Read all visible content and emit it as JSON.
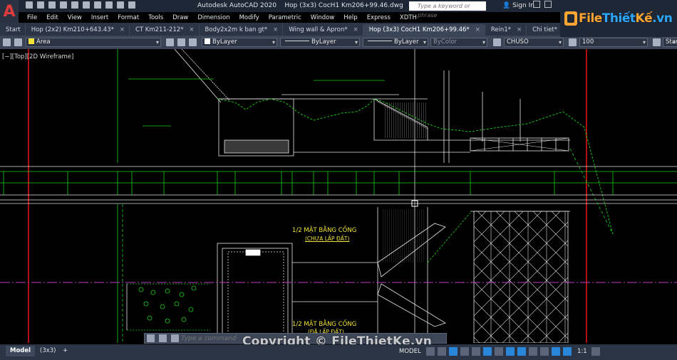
{
  "app": {
    "title": "Autodesk AutoCAD 2020",
    "filename": "Hop (3x3) CocH1 Km206+99.46.dwg",
    "logo_letter": "A"
  },
  "search": {
    "placeholder": "Type a keyword or phrase"
  },
  "account": {
    "signin_label": "Sign In"
  },
  "menu": [
    "File",
    "Edit",
    "View",
    "Insert",
    "Format",
    "Tools",
    "Draw",
    "Dimension",
    "Modify",
    "Parametric",
    "Window",
    "Help",
    "Express",
    "XDTH"
  ],
  "tabs": [
    {
      "label": "Start",
      "closable": false,
      "active": false
    },
    {
      "label": "Hop (2x2)  Km210+643.43*",
      "closable": true,
      "active": false
    },
    {
      "label": "CT Km211-212*",
      "closable": true,
      "active": false
    },
    {
      "label": "Body2x2m k ban gt*",
      "closable": true,
      "active": false
    },
    {
      "label": "Wing wall & Apron*",
      "closable": true,
      "active": false
    },
    {
      "label": "Hop (3x3) CocH1 Km206+99.46*",
      "closable": true,
      "active": true
    },
    {
      "label": "Rein1*",
      "closable": true,
      "active": false
    },
    {
      "label": "Chi tiet*",
      "closable": true,
      "active": false
    }
  ],
  "properties": {
    "layer": "Area",
    "color": "ByLayer",
    "linetype": "ByLayer",
    "lineweight": "ByLayer",
    "plotstyle": "ByColor",
    "textstyle": "CHUSO",
    "dimscale": "100",
    "tablestyle": "Standard"
  },
  "viewport": {
    "label": "[−][Top][2D Wireframe]"
  },
  "drawing": {
    "plan_title_1": "1/2 MẶT BẰNG CỐNG",
    "plan_sub_1": "(CHƯA LẤP ĐẤT)",
    "plan_title_2": "1/2 MẶT BẰNG CỐNG",
    "plan_sub_2": "(ĐÃ LẤP ĐẤT)"
  },
  "command": {
    "placeholder": "Type a command"
  },
  "watermark": {
    "logo_file": "File",
    "logo_thiet": "Thiết",
    "logo_ke": "Kế",
    "logo_vn": ".vn",
    "copyright": "Copyright © FileThietKe.vn"
  },
  "status": {
    "layout_tabs": [
      "Model",
      "(3x3)"
    ],
    "active_layout": "Model",
    "add_tab": "+",
    "space": "MODEL",
    "scale": "1:1"
  },
  "colors": {
    "background": "#000000",
    "red_line": "#e01515",
    "green_line": "#19d219",
    "white_line": "#e6e6e6",
    "magenta_line": "#c53ac5",
    "accent_blue": "#2a86d8"
  }
}
